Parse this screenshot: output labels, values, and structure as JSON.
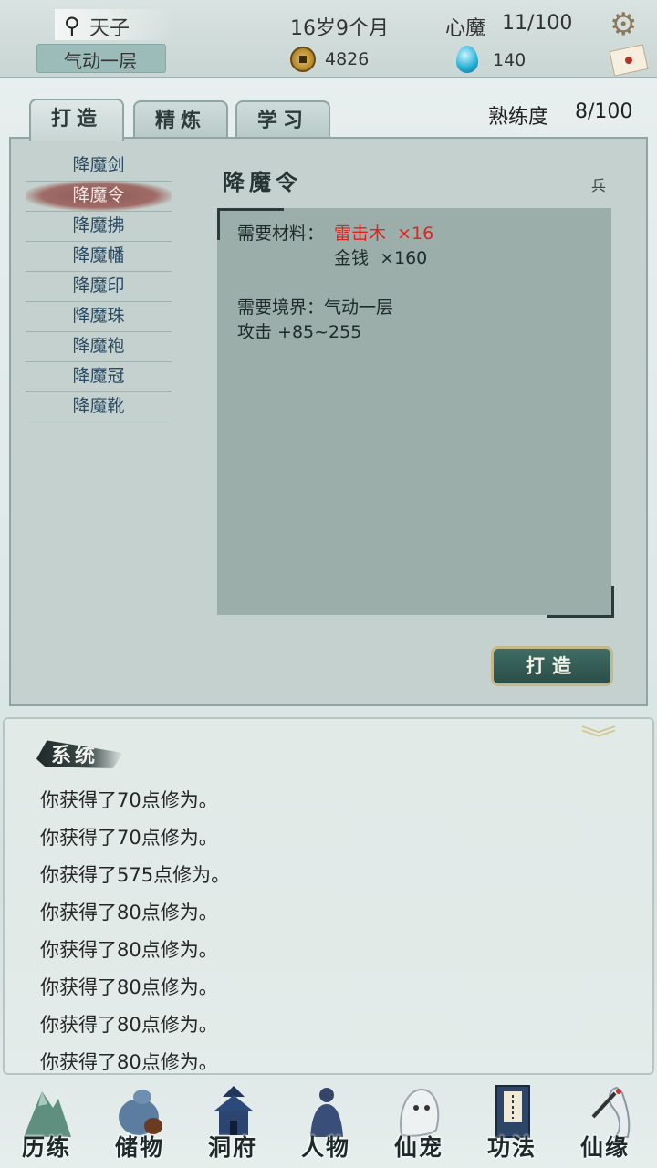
{
  "header": {
    "name": "天子",
    "age": "16岁9个月",
    "heart_demon_label": "心魔",
    "heart_demon_value": "11/100",
    "realm": "气动一层",
    "coins": "4826",
    "gems": "140"
  },
  "tabs": [
    {
      "label": "打造",
      "active": true
    },
    {
      "label": "精炼",
      "active": false
    },
    {
      "label": "学习",
      "active": false
    }
  ],
  "proficiency": {
    "label": "熟练度",
    "value": "8/100"
  },
  "recipe_list": [
    {
      "label": "降魔剑",
      "selected": false
    },
    {
      "label": "降魔令",
      "selected": true
    },
    {
      "label": "降魔拂",
      "selected": false
    },
    {
      "label": "降魔幡",
      "selected": false
    },
    {
      "label": "降魔印",
      "selected": false
    },
    {
      "label": "降魔珠",
      "selected": false
    },
    {
      "label": "降魔袍",
      "selected": false
    },
    {
      "label": "降魔冠",
      "selected": false
    },
    {
      "label": "降魔靴",
      "selected": false
    }
  ],
  "detail": {
    "title": "降魔令",
    "type_tag": "兵",
    "materials_label": "需要材料：",
    "material_1": "雷击木  ×16",
    "material_2": "金钱  ×160",
    "realm_req": "需要境界：气动一层",
    "attack": "攻击 +85~255"
  },
  "forge_button": "打造",
  "log": {
    "title": "系统",
    "lines": [
      "你获得了70点修为。",
      "你获得了70点修为。",
      "你获得了575点修为。",
      "你获得了80点修为。",
      "你获得了80点修为。",
      "你获得了80点修为。",
      "你获得了80点修为。",
      "你获得了80点修为。"
    ]
  },
  "nav": [
    {
      "label": "历练",
      "icon": "mountain-icon"
    },
    {
      "label": "储物",
      "icon": "gourd-bag-icon"
    },
    {
      "label": "洞府",
      "icon": "pagoda-icon"
    },
    {
      "label": "人物",
      "icon": "person-icon"
    },
    {
      "label": "仙宠",
      "icon": "spirit-pet-icon"
    },
    {
      "label": "功法",
      "icon": "scroll-book-icon"
    },
    {
      "label": "仙缘",
      "icon": "crane-icon"
    }
  ],
  "colors": {
    "panel": "#c4d1ce",
    "accent_red": "#e0231f",
    "forge_button": "#2a4d47"
  }
}
